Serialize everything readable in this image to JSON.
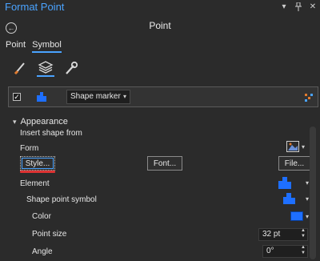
{
  "window": {
    "title": "Format Point"
  },
  "panel": {
    "heading": "Point"
  },
  "tabs": [
    {
      "label": "Point"
    },
    {
      "label": "Symbol"
    }
  ],
  "layer": {
    "shape_select": "Shape marker"
  },
  "appearance": {
    "header": "Appearance",
    "insert_shape_from": "Insert shape from",
    "form_label": "Form",
    "style_button": "Style...",
    "font_button": "Font...",
    "file_button": "File...",
    "element_label": "Element",
    "shape_point_symbol_label": "Shape point symbol",
    "color_label": "Color",
    "point_size_label": "Point size",
    "point_size_value": "32 pt",
    "angle_label": "Angle",
    "angle_value": "0°"
  },
  "colors": {
    "accent": "#4aa3ff",
    "marker_blue": "#1e6fff",
    "underline_red": "#d33333"
  }
}
